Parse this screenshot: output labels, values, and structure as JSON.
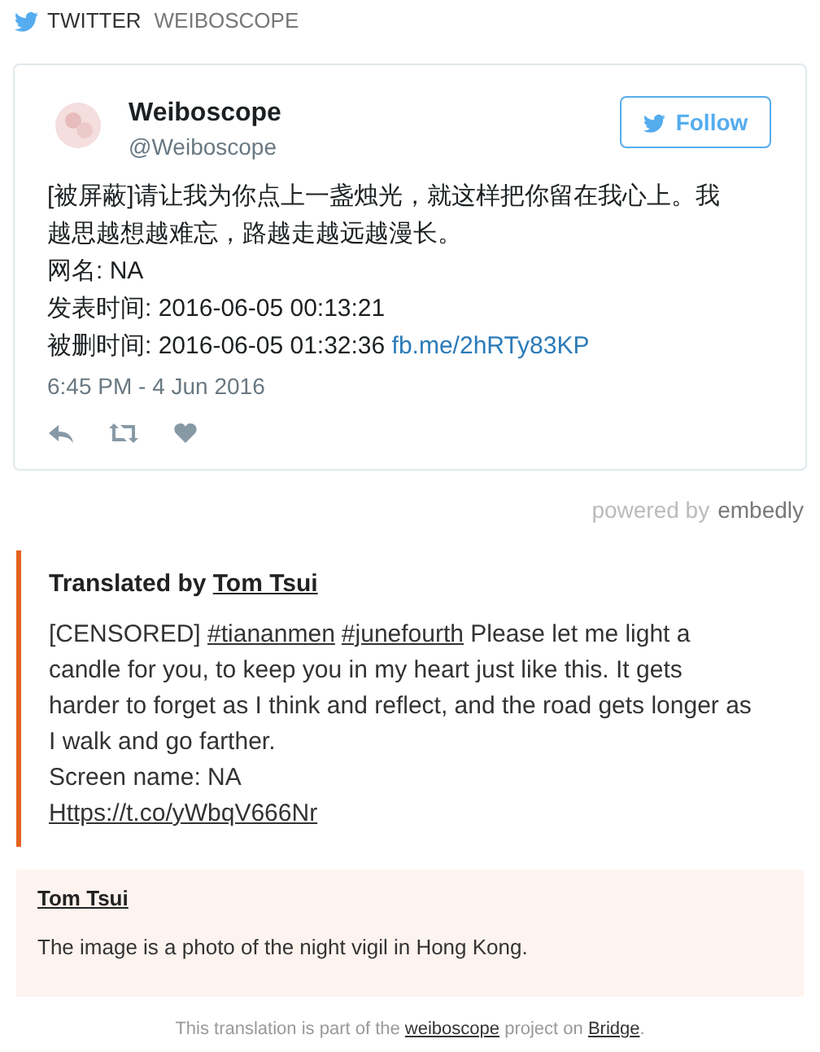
{
  "header": {
    "network": "TWITTER",
    "account": "WEIBOSCOPE"
  },
  "tweet": {
    "name": "Weiboscope",
    "handle": "@Weiboscope",
    "follow_label": "Follow",
    "lines": [
      {
        "text": "[被屏蔽]请让我为你点上一盏烛光，就这样把你留在我心上。我越思越想越难忘，路越走越远越漫长。"
      },
      {
        "text": "网名: NA"
      },
      {
        "text": "发表时间: 2016-06-05 00:13:21"
      },
      {
        "text": "被删时间: 2016-06-05 01:32:36",
        "link": "fb.me/2hRTy83KP"
      }
    ],
    "timestamp": "6:45 PM - 4 Jun 2016"
  },
  "powered_by": {
    "label": "powered by",
    "brand": "embedly"
  },
  "translation": {
    "heading": "Translated by",
    "translator": "Tom Tsui",
    "segments": [
      {
        "kind": "text",
        "text": "[CENSORED] "
      },
      {
        "kind": "link",
        "text": "#tiananmen"
      },
      {
        "kind": "link",
        "text": "#junefourth"
      },
      {
        "kind": "text",
        "text": " Please let me light a candle for you, to keep you in my heart just like this. It gets harder to forget as I think and reflect, and the road gets longer as I walk and go farther."
      }
    ],
    "screen_name": "Screen name: NA",
    "url": "Https://t.co/yWbqV666Nr"
  },
  "note": {
    "author": "Tom Tsui",
    "text": "The image is a photo of the night vigil in Hong Kong."
  },
  "footer": [
    {
      "kind": "text",
      "text": "This translation is part of the "
    },
    {
      "kind": "link",
      "text": "weiboscope"
    },
    {
      "kind": "text",
      "text": " project on "
    },
    {
      "kind": "link",
      "text": "Bridge"
    },
    {
      "kind": "text",
      "text": "."
    }
  ]
}
